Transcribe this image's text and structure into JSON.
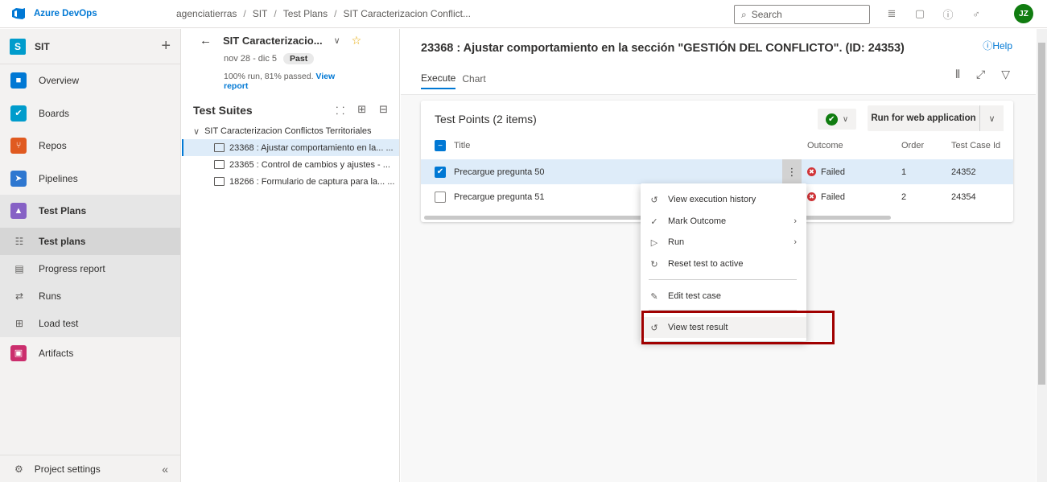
{
  "topbar": {
    "brand": "Azure DevOps",
    "breadcrumb": [
      "agenciatierras",
      "SIT",
      "Test Plans",
      "SIT Caracterizacion Conflict..."
    ],
    "search_placeholder": "Search",
    "avatar_initials": "JZ"
  },
  "sidebar": {
    "project_badge": "S",
    "project_name": "SIT",
    "items": [
      {
        "label": "Overview",
        "icon": "overview-icon",
        "color": "#0078d4"
      },
      {
        "label": "Boards",
        "icon": "boards-icon",
        "color": "#009ccc"
      },
      {
        "label": "Repos",
        "icon": "repos-icon",
        "color": "#e05a20"
      },
      {
        "label": "Pipelines",
        "icon": "pipelines-icon",
        "color": "#2e77d0"
      },
      {
        "label": "Test Plans",
        "icon": "test-plans-icon",
        "color": "#8661c5"
      }
    ],
    "sub_items": [
      {
        "label": "Test plans",
        "icon": "test-plans-list-icon"
      },
      {
        "label": "Progress report",
        "icon": "progress-report-icon"
      },
      {
        "label": "Runs",
        "icon": "runs-icon"
      },
      {
        "label": "Load test",
        "icon": "load-test-icon"
      }
    ],
    "artifacts": "Artifacts",
    "settings": "Project settings"
  },
  "plan": {
    "title": "SIT Caracterizacio...",
    "dates": "nov 28 - dic 5",
    "badge": "Past",
    "progress_text": "100% run, 81% passed.",
    "link_view": "View",
    "link_report": "report"
  },
  "suites": {
    "title": "Test Suites",
    "root": "SIT Caracterizacion Conflictos Territoriales",
    "children": [
      "23368 : Ajustar comportamiento en la... ...",
      "23365 : Control de cambios y ajustes - ...",
      "18266 : Formulario de captura para la... ..."
    ]
  },
  "main": {
    "title": "23368 : Ajustar comportamiento en la sección \"GESTIÓN DEL CONFLICTO\". (ID: 24353)",
    "help": "Help",
    "tabs": [
      "Execute",
      "Chart"
    ],
    "card_title": "Test Points (2 items)",
    "run_button": "Run for web application",
    "columns": {
      "title": "Title",
      "outcome": "Outcome",
      "order": "Order",
      "id": "Test Case Id"
    },
    "rows": [
      {
        "title": "Precargue pregunta 50",
        "outcome": "Failed",
        "order": "1",
        "id": "24352",
        "checked": true
      },
      {
        "title": "Precargue pregunta 51",
        "outcome": "Failed",
        "order": "2",
        "id": "24354",
        "checked": false
      }
    ]
  },
  "context_menu": {
    "items": [
      {
        "label": "View execution history",
        "icon": "history-icon"
      },
      {
        "label": "Mark Outcome",
        "icon": "check-icon",
        "submenu": true
      },
      {
        "label": "Run",
        "icon": "play-icon",
        "submenu": true
      },
      {
        "label": "Reset test to active",
        "icon": "reset-icon"
      },
      {
        "label": "Edit test case",
        "icon": "edit-icon"
      },
      {
        "label": "View test result",
        "icon": "history-icon"
      }
    ]
  }
}
